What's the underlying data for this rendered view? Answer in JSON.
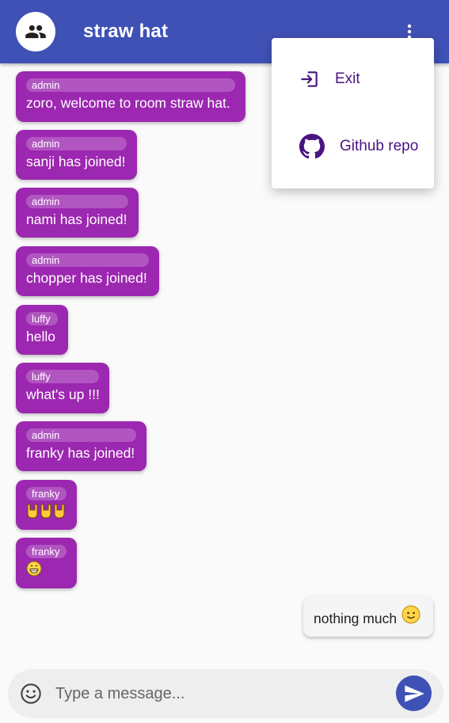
{
  "header": {
    "title": "straw hat",
    "avatar_icon": "group-icon",
    "more_icon": "more-vert-icon",
    "color": "#3f51b5"
  },
  "menu": {
    "items": [
      {
        "label": "Exit",
        "icon": "exit-icon"
      },
      {
        "label": "Github repo",
        "icon": "github-icon"
      }
    ]
  },
  "messages": [
    {
      "sender": "admin",
      "text": "zoro, welcome to room straw hat."
    },
    {
      "sender": "admin",
      "text": "sanji has joined!"
    },
    {
      "sender": "admin",
      "text": "nami has joined!"
    },
    {
      "sender": "admin",
      "text": "chopper has joined!"
    },
    {
      "sender": "luffy",
      "text": "hello"
    },
    {
      "sender": "luffy",
      "text": "what's up !!!"
    },
    {
      "sender": "admin",
      "text": "franky has joined!"
    },
    {
      "sender": "franky",
      "emoji": "rock-on-hands-x3"
    },
    {
      "sender": "franky",
      "emoji": "grinning-face"
    }
  ],
  "own_message": {
    "text": "nothing much",
    "emoji": "slightly-smiling-face"
  },
  "composer": {
    "placeholder": "Type a message..."
  },
  "colors": {
    "bubble": "#9c27b0",
    "accent": "#3f51b5",
    "menu_text": "#4a1580"
  }
}
